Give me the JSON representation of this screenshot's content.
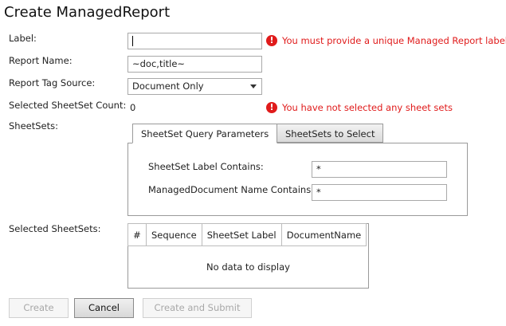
{
  "title": "Create ManagedReport",
  "form": {
    "label_label": "Label:",
    "label_value": "",
    "report_name_label": "Report Name:",
    "report_name_value": "~doc,title~",
    "tag_source_label": "Report Tag Source:",
    "tag_source_value": "Document Only",
    "sheetset_count_label": "Selected SheetSet Count:",
    "sheetset_count_value": "0",
    "sheetsets_label": "SheetSets:",
    "selected_sheetsets_label": "Selected SheetSets:"
  },
  "errors": {
    "label_error": "You must provide a unique Managed Report label",
    "sheetset_error": "You have not selected any sheet sets",
    "icon": "!"
  },
  "tabs": [
    {
      "label": "SheetSet Query Parameters",
      "active": true
    },
    {
      "label": "SheetSets to Select",
      "active": false
    }
  ],
  "query": {
    "label_contains_label": "SheetSet Label Contains:",
    "label_contains_value": "*",
    "docname_contains_label": "ManagedDocument Name Contains:",
    "docname_contains_value": "*"
  },
  "grid": {
    "columns": [
      "#",
      "Sequence",
      "SheetSet Label",
      "DocumentName"
    ],
    "empty_text": "No data to display"
  },
  "buttons": {
    "create": "Create",
    "cancel": "Cancel",
    "create_submit": "Create and Submit"
  }
}
